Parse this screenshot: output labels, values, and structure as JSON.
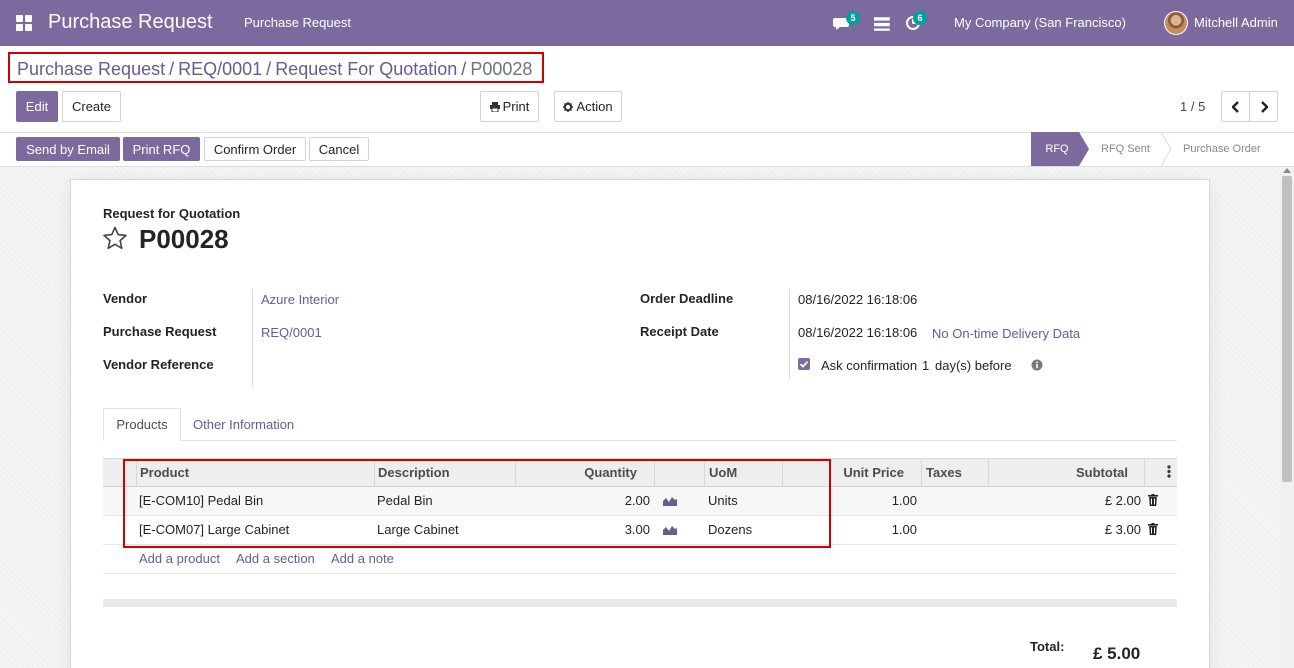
{
  "navbar": {
    "app_title": "Purchase Request",
    "menu_item": "Purchase Request",
    "chat_badge": "5",
    "activity_badge": "6",
    "company": "My Company (San Francisco)",
    "user": "Mitchell Admin",
    "background_color": "#7c6a9f"
  },
  "breadcrumb": {
    "items": [
      "Purchase Request",
      "REQ/0001",
      "Request For Quotation"
    ],
    "current": "P00028"
  },
  "toolbar": {
    "edit": "Edit",
    "create": "Create",
    "print": "Print",
    "action": "Action",
    "pager": "1 / 5"
  },
  "statusbar": {
    "buttons": [
      "Send by Email",
      "Print RFQ",
      "Confirm Order",
      "Cancel"
    ],
    "stages": [
      "RFQ",
      "RFQ Sent",
      "Purchase Order"
    ],
    "active_stage": "RFQ"
  },
  "form": {
    "doc_type": "Request for Quotation",
    "name": "P00028",
    "left_fields": [
      {
        "label": "Vendor",
        "value": "Azure Interior"
      },
      {
        "label": "Purchase Request",
        "value": "REQ/0001"
      },
      {
        "label": "Vendor Reference",
        "value": ""
      }
    ],
    "order_deadline_label": "Order Deadline",
    "order_deadline": "08/16/2022 16:18:06",
    "receipt_date_label": "Receipt Date",
    "receipt_date": "08/16/2022 16:18:06",
    "delivery_data_link": "No On-time Delivery Data",
    "ask_confirmation_prefix": "Ask confirmation",
    "ask_confirmation_days": "1",
    "ask_confirmation_suffix": "day(s) before"
  },
  "tabs": [
    "Products",
    "Other Information"
  ],
  "order_lines": {
    "columns": [
      "Product",
      "Description",
      "Quantity",
      "UoM",
      "Unit Price",
      "Taxes",
      "Subtotal"
    ],
    "rows": [
      {
        "product": "[E-COM10] Pedal Bin",
        "description": "Pedal Bin",
        "quantity": "2.00",
        "uom": "Units",
        "unit_price": "1.00",
        "taxes": "",
        "subtotal": "£ 2.00"
      },
      {
        "product": "[E-COM07] Large Cabinet",
        "description": "Large Cabinet",
        "quantity": "3.00",
        "uom": "Dozens",
        "unit_price": "1.00",
        "taxes": "",
        "subtotal": "£ 3.00"
      }
    ],
    "add_links": [
      "Add a product",
      "Add a section",
      "Add a note"
    ]
  },
  "totals": {
    "label": "Total:",
    "value": "£ 5.00"
  }
}
